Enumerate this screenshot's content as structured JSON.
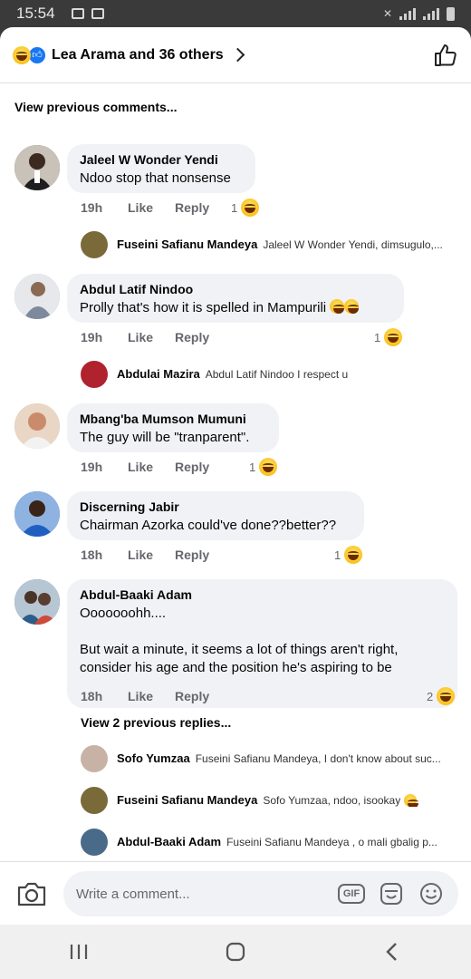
{
  "status_bar": {
    "time": "15:54"
  },
  "header": {
    "title": "Lea Arama and 36 others"
  },
  "view_previous_comments": "View previous comments...",
  "comments": [
    {
      "name": "Jaleel W Wonder Yendi",
      "text": "Ndoo stop that nonsense",
      "time": "19h",
      "like": "Like",
      "reply": "Reply",
      "reactions": "1",
      "avatar_color": "#5a4a3e",
      "reply_preview": {
        "name": "Fuseini Safianu Mandeya",
        "text": "Jaleel W Wonder Yendi, dimsugulo,...",
        "avatar_color": "#7a6a3a"
      }
    },
    {
      "name": "Abdul Latif Nindoo",
      "text": "Prolly that's how it is spelled in Mampurili",
      "time": "19h",
      "like": "Like",
      "reply": "Reply",
      "reactions": "1",
      "avatar_color": "#9aa7b8",
      "reply_preview": {
        "name": "Abdulai Mazira",
        "text": "Abdul Latif Nindoo I respect u",
        "avatar_color": "#b0222e"
      }
    },
    {
      "name": "Mbang'ba Mumson Mumuni",
      "text": "The guy will be \"tranparent\".",
      "time": "19h",
      "like": "Like",
      "reply": "Reply",
      "reactions": "1",
      "avatar_color": "#d8a58a"
    },
    {
      "name": "Discerning Jabir",
      "text": "Chairman Azorka could've done??better??",
      "time": "18h",
      "like": "Like",
      "reply": "Reply",
      "reactions": "1",
      "avatar_color": "#2a66c9"
    },
    {
      "name": "Abdul-Baaki Adam",
      "text": "Ooooooohh....\n\nBut wait a minute, it seems a lot of things aren't right, consider his age and the position he's aspiring to be",
      "time": "18h",
      "like": "Like",
      "reply": "Reply",
      "reactions": "2",
      "avatar_color": "#4a6a8a",
      "view_replies": "View 2 previous replies...",
      "replies": [
        {
          "name": "Sofo Yumzaa",
          "text": "Fuseini Safianu Mandeya, I don't know about suc...",
          "avatar_color": "#c8b2a5"
        },
        {
          "name": "Fuseini Safianu Mandeya",
          "text": "Sofo Yumzaa, ndoo, isookay",
          "avatar_color": "#7a6a3a"
        },
        {
          "name": "Abdul-Baaki Adam",
          "text": "Fuseini Safianu Mandeya , o mali gbalig p...",
          "avatar_color": "#4a6a8a"
        }
      ]
    }
  ],
  "composer": {
    "placeholder": "Write a comment...",
    "gif_label": "GIF"
  },
  "icons": {
    "reaction": "laugh-emoji-icon",
    "like_badge": "like-icon",
    "thumb": "thumbs-up-icon",
    "camera": "camera-icon",
    "sticker": "sticker-icon",
    "emoji": "smiley-icon",
    "nav_recent": "recent-apps-icon",
    "nav_home": "home-icon",
    "nav_back": "back-icon"
  }
}
